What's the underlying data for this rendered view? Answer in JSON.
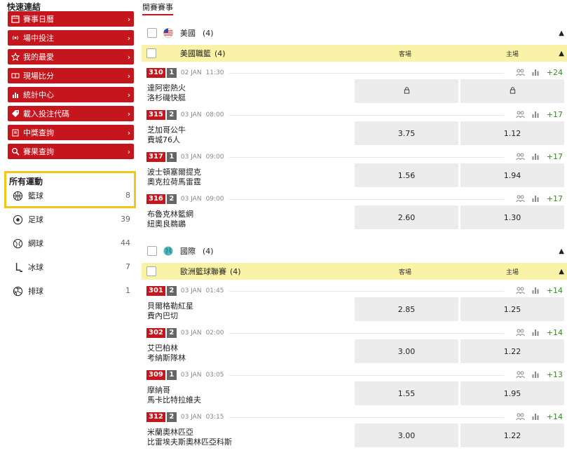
{
  "sidebar": {
    "quick_title": "快速連結",
    "quick_links": [
      {
        "label": "賽事日曆",
        "icon": "calendar-icon"
      },
      {
        "label": "場中投注",
        "icon": "live-icon"
      },
      {
        "label": "我的最愛",
        "icon": "star-icon"
      },
      {
        "label": "現場比分",
        "icon": "scoreboard-icon"
      },
      {
        "label": "統計中心",
        "icon": "stats-icon"
      },
      {
        "label": "載入投注代碼",
        "icon": "tag-icon"
      },
      {
        "label": "中獎查詢",
        "icon": "clipboard-icon"
      },
      {
        "label": "賽果查詢",
        "icon": "search-icon"
      }
    ],
    "chevron": "›",
    "all_sports_title": "所有運動",
    "sports": [
      {
        "label": "籃球",
        "count": "8",
        "icon": "basketball-icon"
      },
      {
        "label": "足球",
        "count": "39",
        "icon": "football-icon"
      },
      {
        "label": "網球",
        "count": "44",
        "icon": "tennis-icon"
      },
      {
        "label": "冰球",
        "count": "7",
        "icon": "ice-hockey-icon"
      },
      {
        "label": "排球",
        "count": "1",
        "icon": "volleyball-icon"
      }
    ]
  },
  "main": {
    "tab": "開賽賽事",
    "col_away": "客場",
    "col_home": "主場",
    "groups": [
      {
        "country": "美國",
        "country_count": "(4)",
        "flag": "us-flag-icon",
        "league": "美國職籃",
        "league_count": "(4)",
        "matches": [
          {
            "id": "310",
            "period": "1",
            "date": "02 JAN",
            "time": "11:30",
            "team1": "達阿密熱火",
            "team2": "洛杉磯快艇",
            "more": "+24",
            "away": "",
            "home": "",
            "locked": true
          },
          {
            "id": "315",
            "period": "2",
            "date": "03 JAN",
            "time": "08:00",
            "team1": "芝加哥公牛",
            "team2": "費城76人",
            "more": "+17",
            "away": "3.75",
            "home": "1.12",
            "locked": false
          },
          {
            "id": "317",
            "period": "1",
            "date": "03 JAN",
            "time": "09:00",
            "team1": "波士頓塞爾提克",
            "team2": "奧克拉荷馬雷霆",
            "more": "+17",
            "away": "1.56",
            "home": "1.94",
            "locked": false
          },
          {
            "id": "316",
            "period": "2",
            "date": "03 JAN",
            "time": "09:00",
            "team1": "布魯克林籃網",
            "team2": "紐奧良鵜鶘",
            "more": "+17",
            "away": "2.60",
            "home": "1.30",
            "locked": false
          }
        ]
      },
      {
        "country": "國際",
        "country_count": "(4)",
        "flag": "globe-icon",
        "league": "歐洲籃球聯賽",
        "league_count": "(4)",
        "matches": [
          {
            "id": "301",
            "period": "2",
            "date": "03 JAN",
            "time": "01:45",
            "team1": "貝爾格勒紅星",
            "team2": "費內巴切",
            "more": "+14",
            "away": "2.85",
            "home": "1.25",
            "locked": false
          },
          {
            "id": "302",
            "period": "2",
            "date": "03 JAN",
            "time": "02:00",
            "team1": "艾巴柏林",
            "team2": "考納斯隊林",
            "more": "+14",
            "away": "3.00",
            "home": "1.22",
            "locked": false
          },
          {
            "id": "309",
            "period": "1",
            "date": "03 JAN",
            "time": "03:05",
            "team1": "摩納哥",
            "team2": "馬卡比特拉維夫",
            "more": "+13",
            "away": "1.55",
            "home": "1.95",
            "locked": false
          },
          {
            "id": "312",
            "period": "2",
            "date": "03 JAN",
            "time": "03:15",
            "team1": "米蘭奧林匹亞",
            "team2": "比雷埃夫斯奧林匹亞科斯",
            "more": "+14",
            "away": "3.00",
            "home": "1.22",
            "locked": false
          }
        ]
      }
    ]
  },
  "colors": {
    "accent": "#c5161d",
    "league_bg": "#faf3a7",
    "highlight": "#f5c518",
    "odds_bg": "#ececec",
    "more": "#3a8a2a"
  }
}
